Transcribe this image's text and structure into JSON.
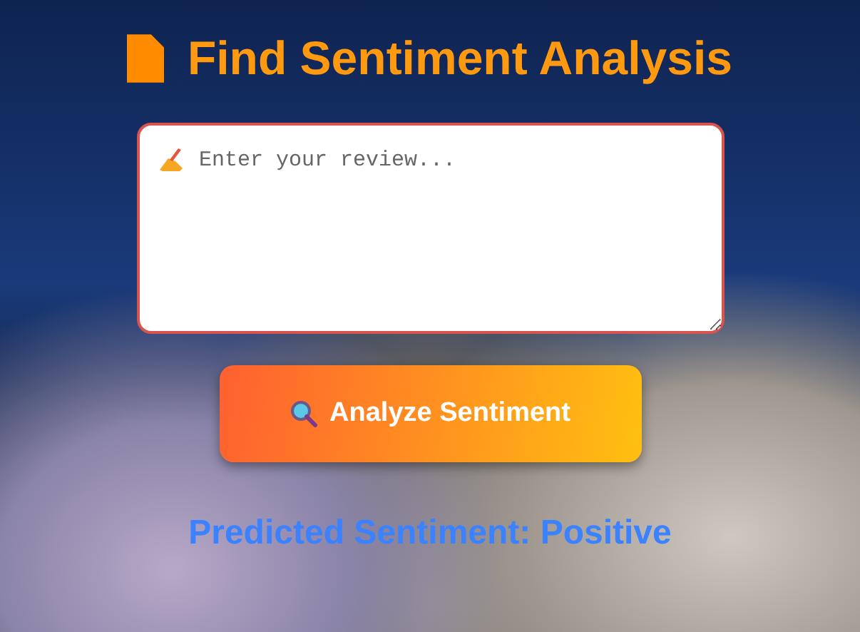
{
  "header": {
    "title": "Find Sentiment Analysis"
  },
  "review_field": {
    "placeholder": "Enter your review..."
  },
  "analyze_button": {
    "label": "Analyze Sentiment"
  },
  "result": {
    "text": "Predicted Sentiment: Positive"
  }
}
